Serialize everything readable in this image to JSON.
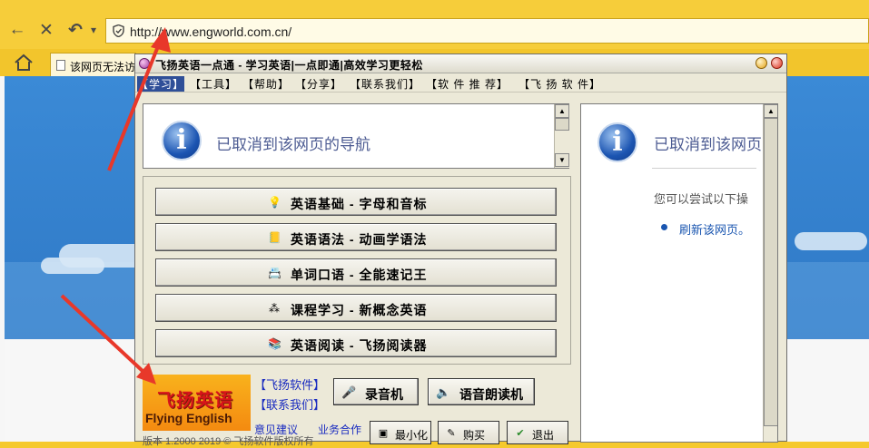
{
  "browser": {
    "url": "http://www.engworld.com.cn/",
    "tab_title": "该网页无法访问",
    "back_glyph": "←",
    "stop_glyph": "✕",
    "undo_glyph": "↶",
    "dropdown_glyph": "▾"
  },
  "app": {
    "title": "飞扬英语一点通 - 学习英语|一点即通|高效学习更轻松",
    "menu": [
      {
        "label": "【学习】",
        "selected": true
      },
      {
        "label": "【工具】"
      },
      {
        "label": "【帮助】"
      },
      {
        "label": "【分享】"
      },
      {
        "label": "【联系我们】"
      },
      {
        "label": "【软 件 推 荐】"
      },
      {
        "label": "【飞 扬 软 件】"
      }
    ],
    "embedded_message": "已取消到该网页的导航",
    "main_buttons": [
      {
        "label": "英语基础 - 字母和音标",
        "icon": "lightbulb-icon"
      },
      {
        "label": "英语语法 - 动画学语法",
        "icon": "book-icon"
      },
      {
        "label": "单词口语 - 全能速记王",
        "icon": "dictionary-icon"
      },
      {
        "label": "课程学习 - 新概念英语",
        "icon": "course-icon"
      },
      {
        "label": "英语阅读 - 飞扬阅读器",
        "icon": "books-icon"
      }
    ],
    "logo": {
      "cn": "飞扬英语",
      "en": "Flying English"
    },
    "links": {
      "software": "【飞扬软件】",
      "contact": "【联系我们】",
      "feedback": "意见建议",
      "business": "业务合作"
    },
    "tools": {
      "recorder": "录音机",
      "reader": "语音朗读机"
    },
    "window_buttons": {
      "minimize": "最小化",
      "buy": "购买",
      "exit": "退出"
    },
    "version_text": "版本 1.2000 2019 © 飞扬软件版权所有"
  },
  "right_pane": {
    "message": "已取消到该网页",
    "hint": "您可以尝试以下操",
    "refresh": "刷新该网页。"
  },
  "colors": {
    "chrome_yellow": "#f6cd3a",
    "menu_selected": "#2f4f98",
    "link_blue": "#1a2cc0",
    "info_blue": "#1c55b2",
    "logo_orange": "#f48a10",
    "arrow_red": "#e8382a"
  }
}
